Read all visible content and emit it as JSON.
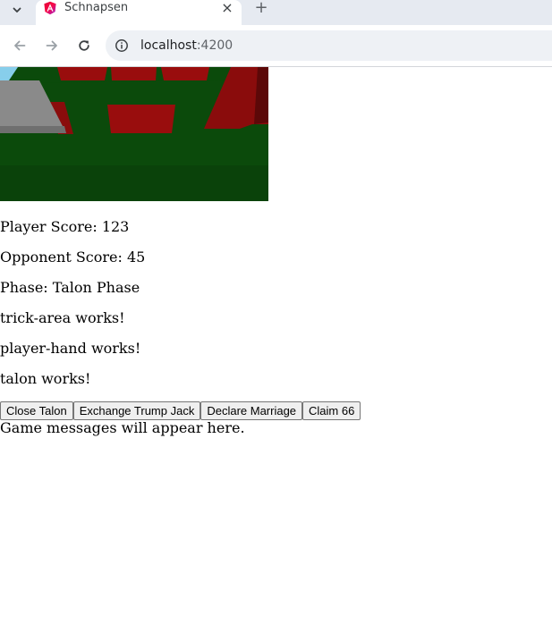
{
  "browser": {
    "tab": {
      "title": "Schnapsen"
    },
    "address_bar": {
      "host": "localhost",
      "port": ":4200"
    }
  },
  "game": {
    "player_score_text": "Player Score: 123",
    "opponent_score_text": "Opponent Score: 45",
    "phase_text": "Phase: Talon Phase",
    "trick_area_text": "trick-area works!",
    "player_hand_text": "player-hand works!",
    "talon_text": "talon works!",
    "message_text": "Game messages will appear here."
  },
  "actions": {
    "close_talon": "Close Talon",
    "exchange_trump_jack": "Exchange Trump Jack",
    "declare_marriage": "Declare Marriage",
    "claim_66": "Claim 66"
  },
  "colors": {
    "table_green": "#0b4a0b",
    "sky": "#87ceeb",
    "card_red": "#990d0d",
    "talon_gray": "#8a8a8a"
  }
}
